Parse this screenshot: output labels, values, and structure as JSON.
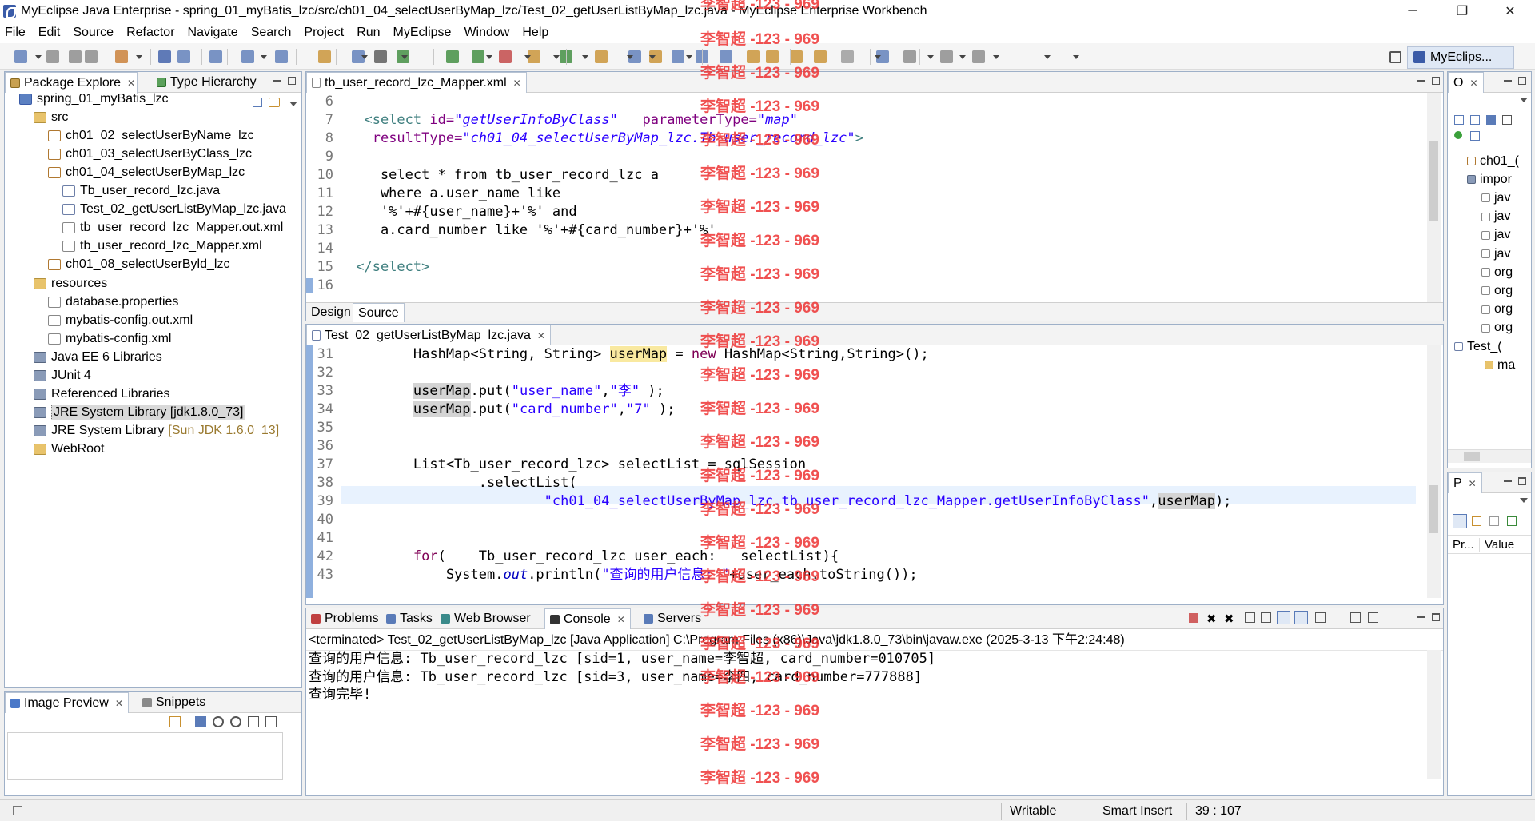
{
  "window": {
    "title": "MyEclipse Java Enterprise - spring_01_myBatis_lzc/src/ch01_04_selectUserByMap_lzc/Test_02_getUserListByMap_lzc.java - MyEclipse Enterprise Workbench",
    "minimize": "─",
    "restore": "❐",
    "close": "✕"
  },
  "menu": [
    "File",
    "Edit",
    "Source",
    "Refactor",
    "Navigate",
    "Search",
    "Project",
    "Run",
    "MyEclipse",
    "Window",
    "Help"
  ],
  "perspective": {
    "label": "MyEclips..."
  },
  "package_explorer": {
    "tabs": [
      {
        "label": "Package Explore"
      },
      {
        "label": "Type Hierarchy"
      }
    ],
    "tree": [
      {
        "label": "spring_01_myBatis_lzc",
        "depth": 0,
        "icon": "project-icon"
      },
      {
        "label": "src",
        "depth": 1,
        "icon": "source-folder-icon"
      },
      {
        "label": "ch01_02_selectUserByName_lzc",
        "depth": 2,
        "icon": "package-icon"
      },
      {
        "label": "ch01_03_selectUserByClass_lzc",
        "depth": 2,
        "icon": "package-icon"
      },
      {
        "label": "ch01_04_selectUserByMap_lzc",
        "depth": 2,
        "icon": "package-icon"
      },
      {
        "label": "Tb_user_record_lzc.java",
        "depth": 3,
        "icon": "java-file-icon"
      },
      {
        "label": "Test_02_getUserListByMap_lzc.java",
        "depth": 3,
        "icon": "java-file-icon"
      },
      {
        "label": "tb_user_record_lzc_Mapper.out.xml",
        "depth": 3,
        "icon": "xml-file-icon"
      },
      {
        "label": "tb_user_record_lzc_Mapper.xml",
        "depth": 3,
        "icon": "xml-file-icon"
      },
      {
        "label": "ch01_08_selectUserByld_lzc",
        "depth": 2,
        "icon": "package-icon"
      },
      {
        "label": "resources",
        "depth": 1,
        "icon": "source-folder-icon"
      },
      {
        "label": "database.properties",
        "depth": 2,
        "icon": "properties-file-icon"
      },
      {
        "label": "mybatis-config.out.xml",
        "depth": 2,
        "icon": "xml-file-icon"
      },
      {
        "label": "mybatis-config.xml",
        "depth": 2,
        "icon": "xml-file-icon"
      },
      {
        "label": "Java EE 6 Libraries",
        "depth": 1,
        "icon": "library-icon"
      },
      {
        "label": "JUnit 4",
        "depth": 1,
        "icon": "library-icon"
      },
      {
        "label": "Referenced Libraries",
        "depth": 1,
        "icon": "library-icon"
      },
      {
        "label": "JRE System Library [jdk1.8.0_73]",
        "depth": 1,
        "icon": "library-icon",
        "selected": true
      },
      {
        "label": "JRE System Library",
        "depth": 1,
        "icon": "library-icon",
        "suffix": "[Sun JDK 1.6.0_13]"
      },
      {
        "label": "WebRoot",
        "depth": 1,
        "icon": "folder-icon"
      }
    ]
  },
  "image_preview": {
    "tabs": [
      {
        "label": "Image Preview"
      },
      {
        "label": "Snippets"
      }
    ]
  },
  "xml_editor": {
    "tab": "tb_user_record_lzc_Mapper.xml",
    "line_numbers": [
      "6",
      "7",
      "8",
      "9",
      "10",
      "11",
      "12",
      "13",
      "14",
      "15",
      "16"
    ],
    "lines": [
      {
        "t": []
      },
      {
        "t": [
          {
            "s": "  "
          },
          {
            "c": "tagc",
            "s": "<select"
          },
          {
            "s": " "
          },
          {
            "c": "attr",
            "s": "id="
          },
          {
            "c": "val",
            "s": "\"getUserInfoByClass\""
          },
          {
            "s": "   "
          },
          {
            "c": "attr",
            "s": "parameterType="
          },
          {
            "c": "val",
            "s": "\"map\""
          }
        ]
      },
      {
        "t": [
          {
            "s": "   "
          },
          {
            "c": "attr",
            "s": "resultType="
          },
          {
            "c": "val",
            "s": "\"ch01_04_selectUserByMap_lzc.Tb_user_record_lzc\""
          },
          {
            "c": "tagc",
            "s": ">"
          }
        ]
      },
      {
        "t": []
      },
      {
        "t": [
          {
            "s": "    select * from tb_user_record_lzc a"
          }
        ]
      },
      {
        "t": [
          {
            "s": "    where a.user_name like"
          }
        ]
      },
      {
        "t": [
          {
            "s": "    '%'+#{user_name}+'%' and"
          }
        ]
      },
      {
        "t": [
          {
            "s": "    a.card_number like '%'+#{card_number}+'%'"
          }
        ]
      },
      {
        "t": []
      },
      {
        "t": [
          {
            "s": " "
          },
          {
            "c": "tagc",
            "s": "</select>"
          }
        ]
      },
      {
        "t": []
      }
    ],
    "bottom_tabs": [
      "Design",
      "Source"
    ]
  },
  "java_editor": {
    "tab": "Test_02_getUserListByMap_lzc.java",
    "line_numbers": [
      "31",
      "32",
      "33",
      "34",
      "35",
      "36",
      "37",
      "38",
      "39",
      "40",
      "41",
      "42",
      "43"
    ],
    "lines": [
      {
        "t": [
          {
            "s": "        HashMap<String, String> "
          },
          {
            "c": "hlY",
            "s": "userMap"
          },
          {
            "s": " = "
          },
          {
            "c": "kw",
            "s": "new"
          },
          {
            "s": " HashMap<String,String>();"
          }
        ]
      },
      {
        "t": []
      },
      {
        "t": [
          {
            "s": "        "
          },
          {
            "c": "hl",
            "s": "userMap"
          },
          {
            "s": ".put("
          },
          {
            "c": "str",
            "s": "\"user_name\""
          },
          {
            "s": ","
          },
          {
            "c": "str",
            "s": "\"李\""
          },
          {
            "s": " );"
          }
        ]
      },
      {
        "t": [
          {
            "s": "        "
          },
          {
            "c": "hl",
            "s": "userMap"
          },
          {
            "s": ".put("
          },
          {
            "c": "str",
            "s": "\"card_number\""
          },
          {
            "s": ","
          },
          {
            "c": "str",
            "s": "\"7\""
          },
          {
            "s": " );"
          }
        ]
      },
      {
        "t": []
      },
      {
        "t": []
      },
      {
        "t": [
          {
            "s": "        List<Tb_user_record_lzc> selectList = sqlSession"
          }
        ]
      },
      {
        "t": [
          {
            "s": "                .selectList("
          }
        ]
      },
      {
        "t": [
          {
            "s": "                        "
          },
          {
            "c": "str",
            "s": "\"ch01_04_selectUserByMap_lzc.tb_user_record_lzc_Mapper.getUserInfoByClass\""
          },
          {
            "s": ","
          },
          {
            "c": "hl",
            "s": "userMap"
          },
          {
            "s": ");"
          }
        ],
        "current": true
      },
      {
        "t": []
      },
      {
        "t": []
      },
      {
        "t": [
          {
            "s": "        "
          },
          {
            "c": "kw",
            "s": "for"
          },
          {
            "s": "(    Tb_user_record_lzc user_each:   selectList){"
          }
        ]
      },
      {
        "t": [
          {
            "s": "            System."
          },
          {
            "c": "out",
            "s": "out"
          },
          {
            "s": ".println("
          },
          {
            "c": "str",
            "s": "\"查询的用户信息: \""
          },
          {
            "s": "+user_each.toString());"
          }
        ]
      }
    ]
  },
  "console": {
    "tabs": [
      {
        "label": "Problems"
      },
      {
        "label": "Tasks"
      },
      {
        "label": "Web Browser"
      },
      {
        "label": "Console",
        "active": true
      },
      {
        "label": "Servers"
      }
    ],
    "header": "<terminated> Test_02_getUserListByMap_lzc [Java Application] C:\\Program Files (x86)\\Java\\jdk1.8.0_73\\bin\\javaw.exe (2025-3-13 下午2:24:48)",
    "lines": [
      "查询的用户信息: Tb_user_record_lzc [sid=1, user_name=李智超, card_number=010705]",
      "查询的用户信息: Tb_user_record_lzc [sid=3, user_name=李四, card_number=777888]",
      "查询完毕!"
    ]
  },
  "outline": {
    "tab": "O",
    "rows": [
      {
        "label": "ch01_("
      },
      {
        "label": "impor"
      },
      {
        "label": "jav"
      },
      {
        "label": "jav"
      },
      {
        "label": "jav"
      },
      {
        "label": "jav"
      },
      {
        "label": "org"
      },
      {
        "label": "org"
      },
      {
        "label": "org"
      },
      {
        "label": "org"
      },
      {
        "label": "Test_("
      },
      {
        "label": "ma"
      }
    ]
  },
  "properties": {
    "tab": "P",
    "col1": "Pr...",
    "col2": "Value"
  },
  "statusbar": {
    "writable": "Writable",
    "insert": "Smart Insert",
    "position": "39 : 107"
  },
  "watermark": "李智超 -123 - 969",
  "colors": {
    "accent": "#3a5ba8",
    "watermark": "#ee3333",
    "keyword": "#7f0055",
    "string": "#2a00ff"
  }
}
